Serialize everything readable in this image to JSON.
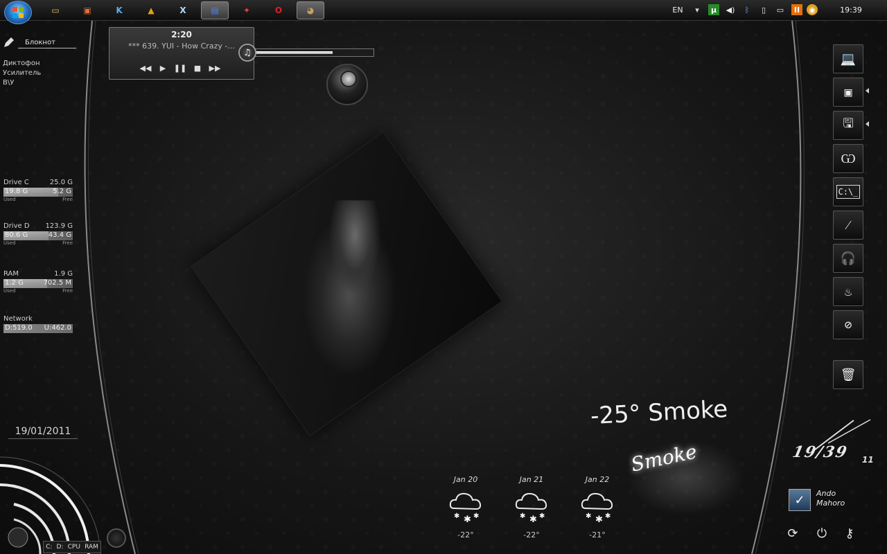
{
  "taskbar": {
    "apps": [
      {
        "name": "explorer-icon",
        "glyph": "▭",
        "color": "#e0c060"
      },
      {
        "name": "windows-app-icon",
        "glyph": "▣",
        "color": "#e07040"
      },
      {
        "name": "k-app-icon",
        "glyph": "K",
        "color": "#5ab0f0"
      },
      {
        "name": "aimp-icon",
        "glyph": "▲",
        "color": "#e0a020"
      },
      {
        "name": "xnview-icon",
        "glyph": "X",
        "color": "#aaddff"
      },
      {
        "name": "floppy-app-icon",
        "glyph": "▤",
        "color": "#4a80ff"
      },
      {
        "name": "firefox-icon",
        "glyph": "✦",
        "color": "#e04040"
      },
      {
        "name": "opera-icon",
        "glyph": "O",
        "color": "#e02020"
      },
      {
        "name": "gimp-icon",
        "glyph": "◕",
        "color": "#c8a060"
      }
    ],
    "tray": {
      "language": "EN",
      "clock": "19:39"
    }
  },
  "left_panel": {
    "notepad_label": "Блокнот",
    "launchers": [
      "Диктофон",
      "Усилитель",
      "В\\У"
    ],
    "drives": [
      {
        "title": "Drive C",
        "total": "25.0 G",
        "used": "19.8 G",
        "free": "5.2 G",
        "used_fraction": 0.79,
        "used_label": "Used",
        "free_label": "Free"
      },
      {
        "title": "Drive D",
        "total": "123.9 G",
        "used": "80.6 G",
        "free": "43.4 G",
        "used_fraction": 0.65,
        "used_label": "Used",
        "free_label": "Free"
      },
      {
        "title": "RAM",
        "total": "1.9 G",
        "used": "1.2 G",
        "free": "702.5 M",
        "used_fraction": 0.63,
        "used_label": "Used",
        "free_label": "Free"
      }
    ],
    "network": {
      "title": "Network",
      "down": "D:519.0",
      "up": "U:462.0"
    },
    "date": "19/01/2011",
    "gauge_labels": [
      "C:",
      "D:",
      "CPU",
      "RAM"
    ]
  },
  "player": {
    "elapsed": "2:20",
    "track": "*** 639. YUI - How Crazy -...",
    "progress_fraction": 0.66
  },
  "weather": {
    "current": "-25° Smoke",
    "art_word": "Smoke",
    "forecast": [
      {
        "date": "Jan 20",
        "temp": "-22°"
      },
      {
        "date": "Jan 21",
        "temp": "-22°"
      },
      {
        "date": "Jan 22",
        "temp": "-21°"
      }
    ]
  },
  "dock": {
    "items": [
      "laptop-icon",
      "media-player-icon",
      "floppy-disk-icon",
      "claw-logo-icon",
      "command-prompt-icon",
      "magic-wand-icon",
      "headphones-icon",
      "fire-icon",
      "compass-icon",
      "recycle-bin-icon"
    ],
    "cmd_text": "C:\\_"
  },
  "clock": {
    "time": "19/39",
    "seconds": "11"
  },
  "user": {
    "line1": "Ando",
    "line2": "Mahoro"
  }
}
